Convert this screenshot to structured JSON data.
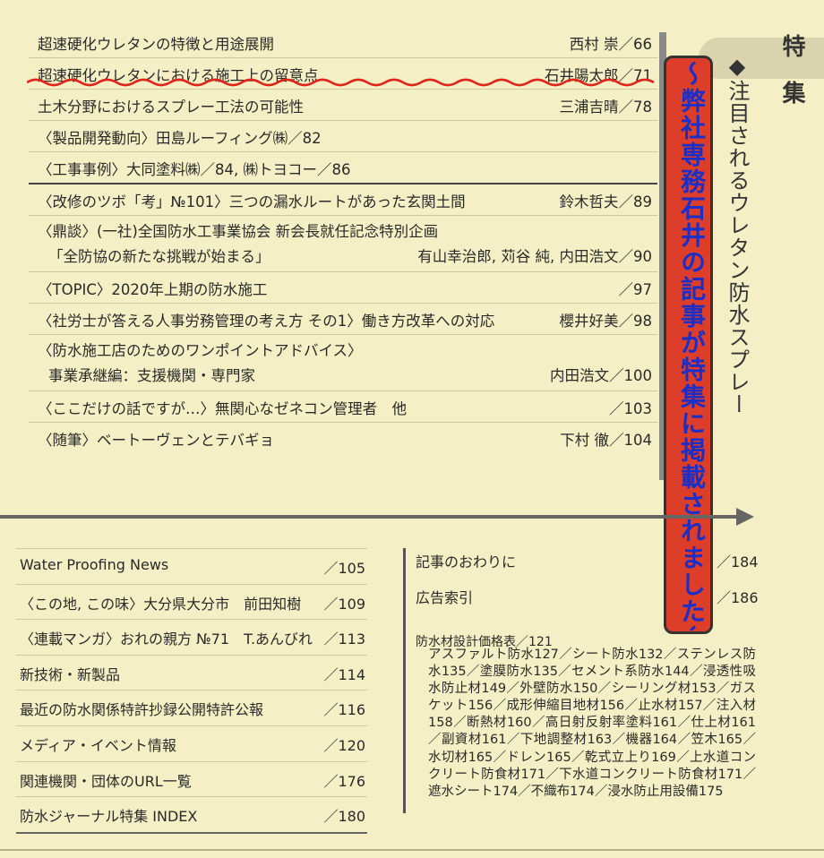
{
  "toc": [
    {
      "title": "超速硬化ウレタンの特徴と用途展開",
      "author": "西村 崇／66"
    },
    {
      "title": "超速硬化ウレタンにおける施工上の留意点",
      "author": "石井陽太郎／71"
    },
    {
      "title": "土木分野におけるスプレー工法の可能性",
      "author": "三浦吉晴／78"
    },
    {
      "title": "〈製品開発動向〉田島ルーフィング㈱／82",
      "author": ""
    },
    {
      "title": "〈工事事例〉大同塗料㈱／84, ㈱トヨコー／86",
      "author": ""
    },
    {
      "title": "〈改修のツボ「考」№101〉三つの漏水ルートがあった玄関土間",
      "author": "鈴木哲夫／89"
    },
    {
      "title": "〈鼎談〉(一社)全国防水工事業協会 新会長就任記念特別企画",
      "title2": "「全防協の新たな挑戦が始まる」",
      "author": "有山幸治郎, 苅谷 純, 内田浩文／90"
    },
    {
      "title": "〈TOPIC〉2020年上期の防水施工",
      "author": "／97"
    },
    {
      "title": "〈社労士が答える人事労務管理の考え方 その1〉働き方改革への対応",
      "author": "櫻井好美／98"
    },
    {
      "title": "〈防水施工店のためのワンポイントアドバイス〉",
      "title2": "事業承継編：支援機関・専門家",
      "author": "内田浩文／100"
    },
    {
      "title": "〈ここだけの話ですが…〉無関心なゼネコン管理者　他",
      "author": "／103"
    },
    {
      "title": "〈随筆〉ベートーヴェンとテバギョ",
      "author": "下村 徹／104"
    }
  ],
  "side": {
    "tokushu": "特集",
    "feature_title": "◆注目されるウレタン防水スプレー",
    "annotation": "〜弊社専務石井の記事が特集に掲載されました〜"
  },
  "bottom_left": [
    {
      "title": "Water Proofing News",
      "page": "／105"
    },
    {
      "title": "〈この地, この味〉大分県大分市　前田知樹",
      "page": "／109"
    },
    {
      "title": "〈連載マンガ〉おれの親方 №71　T.あんびれ",
      "page": "／113"
    },
    {
      "title": "新技術・新製品",
      "page": "／114"
    },
    {
      "title": "最近の防水関係特許抄録公開特許公報",
      "page": "／116"
    },
    {
      "title": "メディア・イベント情報",
      "page": "／120"
    },
    {
      "title": "関連機関・団体のURL一覧",
      "page": "／176"
    },
    {
      "title": "防水ジャーナル特集 INDEX",
      "page": "／180"
    }
  ],
  "bottom_right": {
    "items": [
      {
        "title": "記事のおわりに",
        "page": "／184"
      },
      {
        "title": "広告索引",
        "page": "／186"
      }
    ],
    "price_head": "防水材設計価格表／121",
    "price_body": "アスファルト防水127／シート防水132／ステンレス防水135／塗膜防水135／セメント系防水144／浸透性吸水防止材149／外壁防水150／シーリング材153／ガスケット156／成形伸縮目地材156／止水材157／注入材158／断熱材160／高日射反射率塗料161／仕上材161／副資材161／下地調整材163／機器164／笠木165／水切材165／ドレン165／乾式立上り169／上水道コンクリート防食材171／下水道コンクリート防食材171／遮水シート174／不織布174／浸水防止用設備175"
  }
}
